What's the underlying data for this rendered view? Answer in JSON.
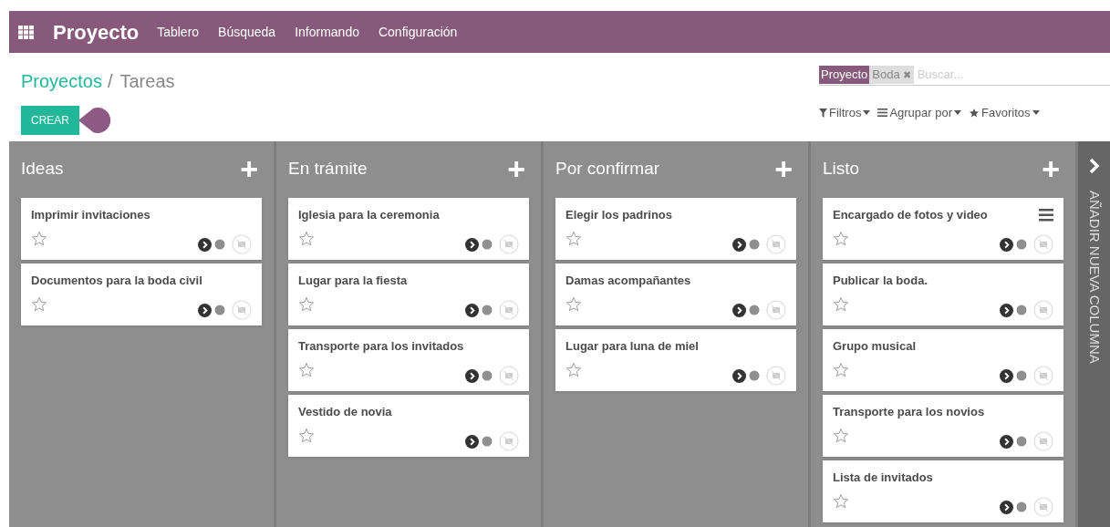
{
  "app": {
    "title": "Proyecto",
    "menu": [
      "Tablero",
      "Búsqueda",
      "Informando",
      "Configuración"
    ]
  },
  "breadcrumb": {
    "parent": "Proyectos",
    "separator": "/",
    "current": "Tareas"
  },
  "create_button": "CREAR",
  "search": {
    "facet_label": "Proyecto",
    "facet_value": "Boda",
    "remove": "✖",
    "placeholder": "Buscar..."
  },
  "search_options": [
    "Filtros",
    "Agrupar por",
    "Favoritos"
  ],
  "columns": [
    {
      "title": "Ideas",
      "add": "+",
      "cards": [
        {
          "title": "Imprimir invitaciones",
          "starred": false,
          "has_menu": false
        },
        {
          "title": "Documentos para la boda civil",
          "starred": false,
          "has_menu": false
        }
      ]
    },
    {
      "title": "En trámite",
      "add": "+",
      "cards": [
        {
          "title": "Iglesia para la ceremonia",
          "starred": false,
          "has_menu": false
        },
        {
          "title": "Lugar para la fiesta",
          "starred": false,
          "has_menu": false
        },
        {
          "title": "Transporte para los invitados",
          "starred": false,
          "has_menu": false
        },
        {
          "title": "Vestido de novia",
          "starred": false,
          "has_menu": false
        }
      ]
    },
    {
      "title": "Por confirmar",
      "add": "+",
      "cards": [
        {
          "title": "Elegir los padrinos",
          "starred": false,
          "has_menu": false
        },
        {
          "title": "Damas acompañantes",
          "starred": false,
          "has_menu": false
        },
        {
          "title": "Lugar para luna de miel",
          "starred": false,
          "has_menu": false
        }
      ]
    },
    {
      "title": "Listo",
      "add": "+",
      "cards": [
        {
          "title": "Encargado de fotos y video",
          "starred": false,
          "has_menu": true
        },
        {
          "title": "Publicar la boda.",
          "starred": false,
          "has_menu": false
        },
        {
          "title": "Grupo musical",
          "starred": false,
          "has_menu": false
        },
        {
          "title": "Transporte para los novios",
          "starred": false,
          "has_menu": false
        },
        {
          "title": "Lista de invitados",
          "starred": false,
          "has_menu": false
        }
      ]
    }
  ],
  "add_column": "AÑADIR NUEVA COLUMNA"
}
